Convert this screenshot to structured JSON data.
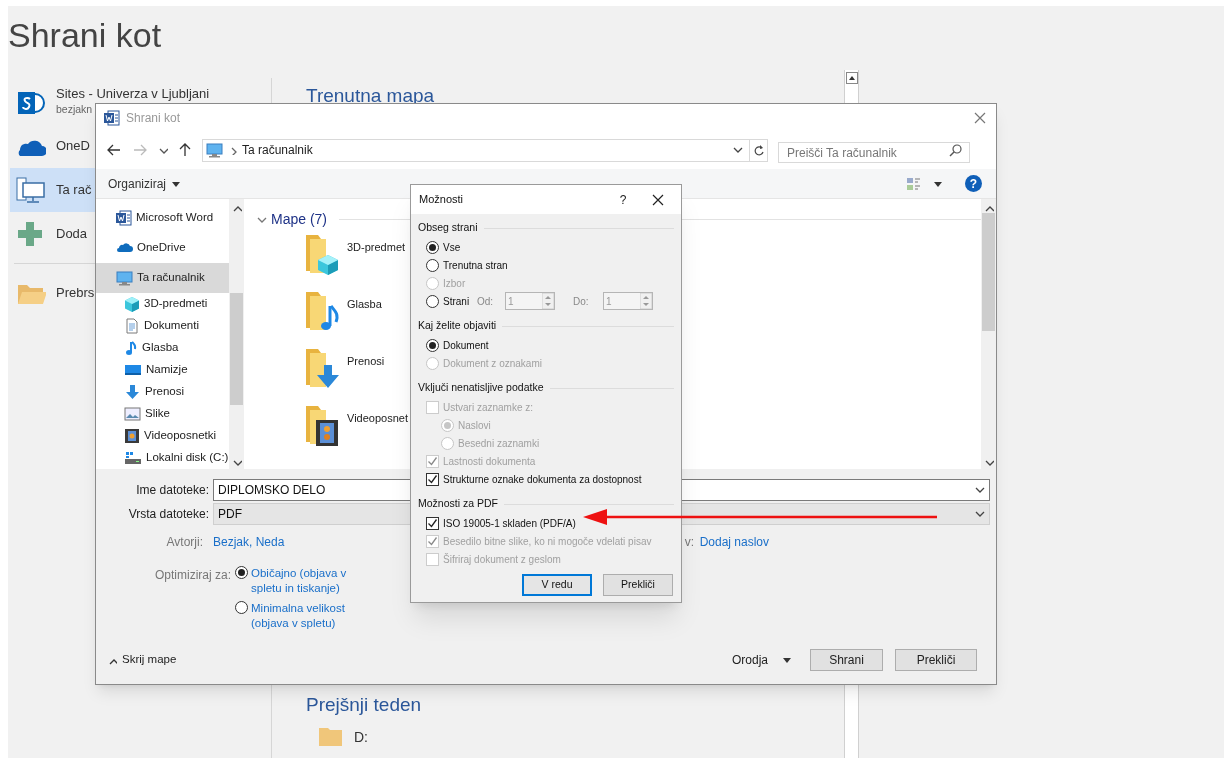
{
  "backstage": {
    "title": "Shrani kot",
    "places": [
      {
        "kind": "sharepoint",
        "label": "Sites - Univerza v Ljubljani",
        "sublabel": "bezjakn",
        "selected": false
      },
      {
        "kind": "onedrive",
        "label": "OneD",
        "selected": false
      },
      {
        "kind": "computer",
        "label": "Ta rač",
        "selected": true
      },
      {
        "kind": "add",
        "label": "Doda",
        "selected": false
      },
      {
        "kind": "browse",
        "label": "Prebrs",
        "selected": false
      }
    ],
    "current_folder_heading": "Trenutna mapa",
    "last_week_heading": "Prejšnji teden",
    "last_week_items": [
      {
        "label": "D:"
      }
    ]
  },
  "save_dialog": {
    "title": "Shrani kot",
    "breadcrumb": "Ta računalnik",
    "search_placeholder": "Preišči Ta računalnik",
    "organize_button": "Organiziraj",
    "help_glyph": "?",
    "nav_items": [
      {
        "kind": "word",
        "label": "Microsoft Word",
        "selected": false
      },
      {
        "kind": "onedrive",
        "label": "OneDrive",
        "selected": false
      },
      {
        "kind": "computer",
        "label": "Ta računalnik",
        "selected": true,
        "children": [
          {
            "kind": "cube",
            "label": "3D-predmeti",
            "selected": false
          },
          {
            "kind": "documents",
            "label": "Dokumenti",
            "selected": false
          },
          {
            "kind": "music",
            "label": "Glasba",
            "selected": false
          },
          {
            "kind": "desktop",
            "label": "Namizje",
            "selected": false
          },
          {
            "kind": "downloads",
            "label": "Prenosi",
            "selected": false
          },
          {
            "kind": "pictures",
            "label": "Slike",
            "selected": false
          },
          {
            "kind": "videos",
            "label": "Videoposnetki",
            "selected": false
          },
          {
            "kind": "drive",
            "label": "Lokalni disk (C:)",
            "selected": false
          }
        ]
      }
    ],
    "folders_heading": "Mape (7)",
    "folders": [
      {
        "kind": "cube",
        "label": "3D-predmet"
      },
      {
        "kind": "music",
        "label": "Glasba"
      },
      {
        "kind": "downloads",
        "label": "Prenosi"
      },
      {
        "kind": "videos",
        "label": "Videoposnet"
      }
    ],
    "file_name_label": "Ime datoteke:",
    "file_name": "DIPLOMSKO DELO",
    "file_type_label": "Vrsta datoteke:",
    "file_type": "PDF",
    "authors_label": "Avtorji:",
    "authors": "Bezjak, Neda",
    "title_label": "v:",
    "title_value": "Dodaj naslov",
    "optimize_label": "Optimiziraj za:",
    "optimize_options": [
      {
        "label": "Običajno (objava v spletu in tiskanje)",
        "selected": true
      },
      {
        "label": "Minimalna velikost (objava v spletu)",
        "selected": false
      }
    ],
    "hide_folders": "Skrij mape",
    "tools": "Orodja",
    "save_button": "Shrani",
    "cancel_button": "Prekliči"
  },
  "options_dialog": {
    "title": "Možnosti",
    "help": "?",
    "sections": [
      {
        "heading": "Obseg strani",
        "items": [
          {
            "kind": "radio",
            "label": "Vse",
            "selected": true,
            "disabled": false
          },
          {
            "kind": "radio",
            "label": "Trenutna stran",
            "selected": false,
            "disabled": false
          },
          {
            "kind": "radio",
            "label": "Izbor",
            "selected": false,
            "disabled": true
          },
          {
            "kind": "range",
            "label": "Strani",
            "selected": false,
            "disabled": false,
            "from_label": "Od:",
            "from_value": "1",
            "to_label": "Do:",
            "to_value": "1"
          }
        ]
      },
      {
        "heading": "Kaj želite objaviti",
        "items": [
          {
            "kind": "radio",
            "label": "Dokument",
            "selected": true,
            "disabled": false
          },
          {
            "kind": "radio",
            "label": "Dokument z oznakami",
            "selected": false,
            "disabled": true
          }
        ]
      },
      {
        "heading": "Vključi nenatisljive podatke",
        "items": [
          {
            "kind": "checkbox",
            "label": "Ustvari zaznamke z:",
            "checked": false,
            "disabled": true,
            "children": [
              {
                "kind": "radio",
                "label": "Naslovi",
                "selected": true,
                "disabled": true
              },
              {
                "kind": "radio",
                "label": "Besedni zaznamki",
                "selected": false,
                "disabled": true
              }
            ]
          },
          {
            "kind": "checkbox",
            "label": "Lastnosti dokumenta",
            "checked": true,
            "disabled": true
          },
          {
            "kind": "checkbox",
            "label": "Strukturne oznake dokumenta za dostopnost",
            "checked": true,
            "disabled": false
          }
        ]
      },
      {
        "heading": "Možnosti za PDF",
        "items": [
          {
            "kind": "checkbox",
            "label": "ISO 19005-1 skladen (PDF/A)",
            "checked": true,
            "disabled": false
          },
          {
            "kind": "checkbox",
            "label": "Besedilo bitne slike, ko ni mogoče vdelati pisav",
            "checked": true,
            "disabled": true
          },
          {
            "kind": "checkbox",
            "label": "Šifriraj dokument z geslom",
            "checked": false,
            "disabled": true
          }
        ]
      }
    ],
    "ok_button": "V redu",
    "cancel_button": "Prekliči"
  }
}
